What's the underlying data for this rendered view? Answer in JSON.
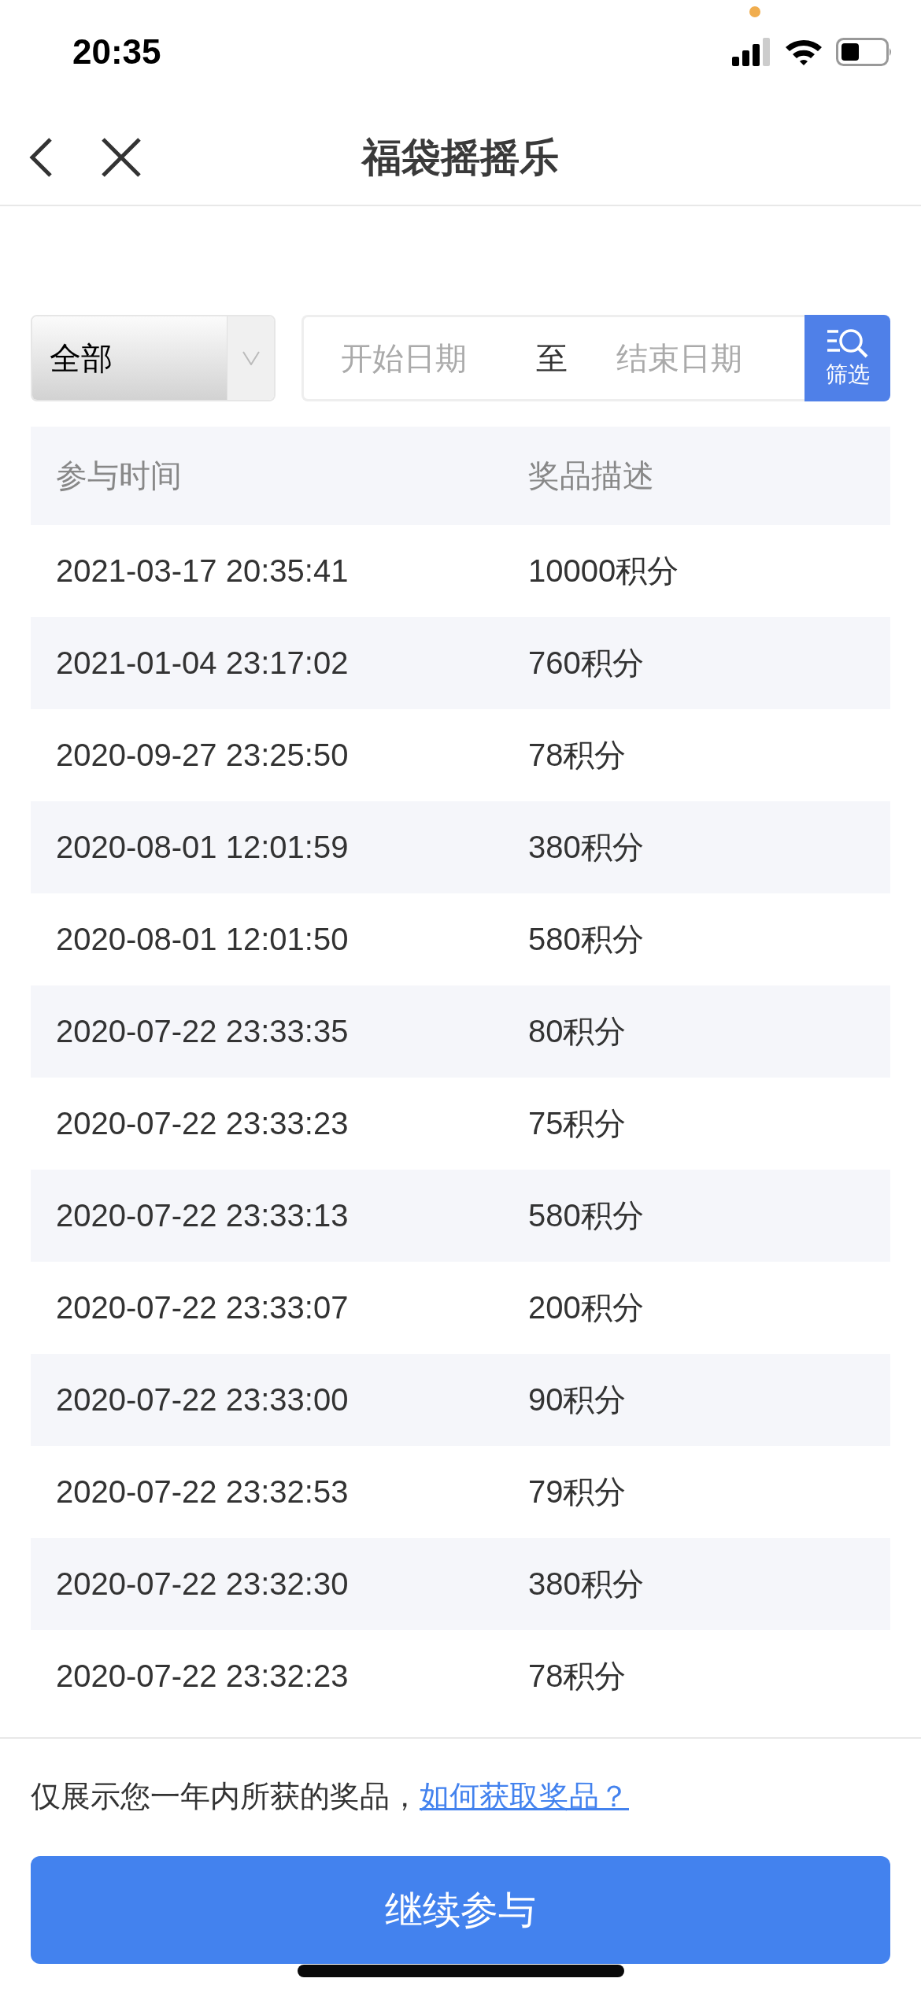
{
  "status_bar": {
    "time": "20:35"
  },
  "nav": {
    "title": "福袋摇摇乐"
  },
  "filter": {
    "category": "全部",
    "start_placeholder": "开始日期",
    "separator": "至",
    "end_placeholder": "结束日期",
    "button": "筛选"
  },
  "table": {
    "columns": [
      "参与时间",
      "奖品描述"
    ],
    "rows": [
      {
        "time": "2021-03-17 20:35:41",
        "prize": "10000积分"
      },
      {
        "time": "2021-01-04 23:17:02",
        "prize": "760积分"
      },
      {
        "time": "2020-09-27 23:25:50",
        "prize": "78积分"
      },
      {
        "time": "2020-08-01 12:01:59",
        "prize": "380积分"
      },
      {
        "time": "2020-08-01 12:01:50",
        "prize": "580积分"
      },
      {
        "time": "2020-07-22 23:33:35",
        "prize": "80积分"
      },
      {
        "time": "2020-07-22 23:33:23",
        "prize": "75积分"
      },
      {
        "time": "2020-07-22 23:33:13",
        "prize": "580积分"
      },
      {
        "time": "2020-07-22 23:33:07",
        "prize": "200积分"
      },
      {
        "time": "2020-07-22 23:33:00",
        "prize": "90积分"
      },
      {
        "time": "2020-07-22 23:32:53",
        "prize": "79积分"
      },
      {
        "time": "2020-07-22 23:32:30",
        "prize": "380积分"
      },
      {
        "time": "2020-07-22 23:32:23",
        "prize": "78积分"
      }
    ]
  },
  "footer": {
    "note": "仅展示您一年内所获的奖品，",
    "link": "如何获取奖品？",
    "button": "继续参与"
  }
}
